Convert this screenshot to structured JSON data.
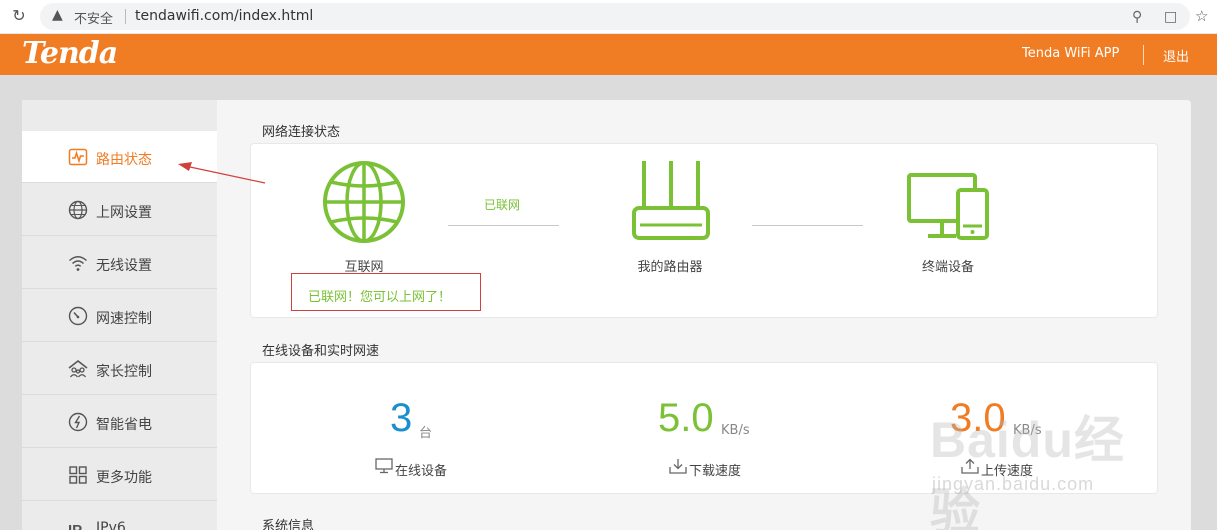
{
  "browser": {
    "security_label": "不安全",
    "url": "tendawifi.com/index.html"
  },
  "header": {
    "logo": "Tenda",
    "app_link": "Tenda WiFi APP",
    "logout": "退出"
  },
  "sidebar": {
    "items": [
      {
        "label": "路由状态",
        "icon": "router-status-icon",
        "active": true
      },
      {
        "label": "上网设置",
        "icon": "globe-icon"
      },
      {
        "label": "无线设置",
        "icon": "wifi-icon"
      },
      {
        "label": "网速控制",
        "icon": "speedometer-icon"
      },
      {
        "label": "家长控制",
        "icon": "parental-icon"
      },
      {
        "label": "智能省电",
        "icon": "power-save-icon"
      },
      {
        "label": "更多功能",
        "icon": "grid-icon"
      },
      {
        "label": "IPv6",
        "icon": "ipv6-icon"
      }
    ]
  },
  "network": {
    "title": "网络连接状态",
    "internet_label": "互联网",
    "connected_status": "已联网",
    "router_label": "我的路由器",
    "devices_label": "终端设备",
    "message": "已联网！您可以上网了！"
  },
  "online": {
    "title": "在线设备和实时网速",
    "devices_count": "3",
    "devices_unit": "台",
    "devices_label": "在线设备",
    "download_value": "5.0",
    "download_unit": "KB/s",
    "download_label": "下载速度",
    "upload_value": "3.0",
    "upload_unit": "KB/s",
    "upload_label": "上传速度"
  },
  "system": {
    "title": "系统信息"
  },
  "watermark": {
    "logo": "Baidu经验",
    "url": "jingyan.baidu.com"
  },
  "colors": {
    "accent": "#f07d24",
    "green": "#7ac136",
    "blue": "#1a8fd0",
    "annotation": "#d0403c"
  }
}
